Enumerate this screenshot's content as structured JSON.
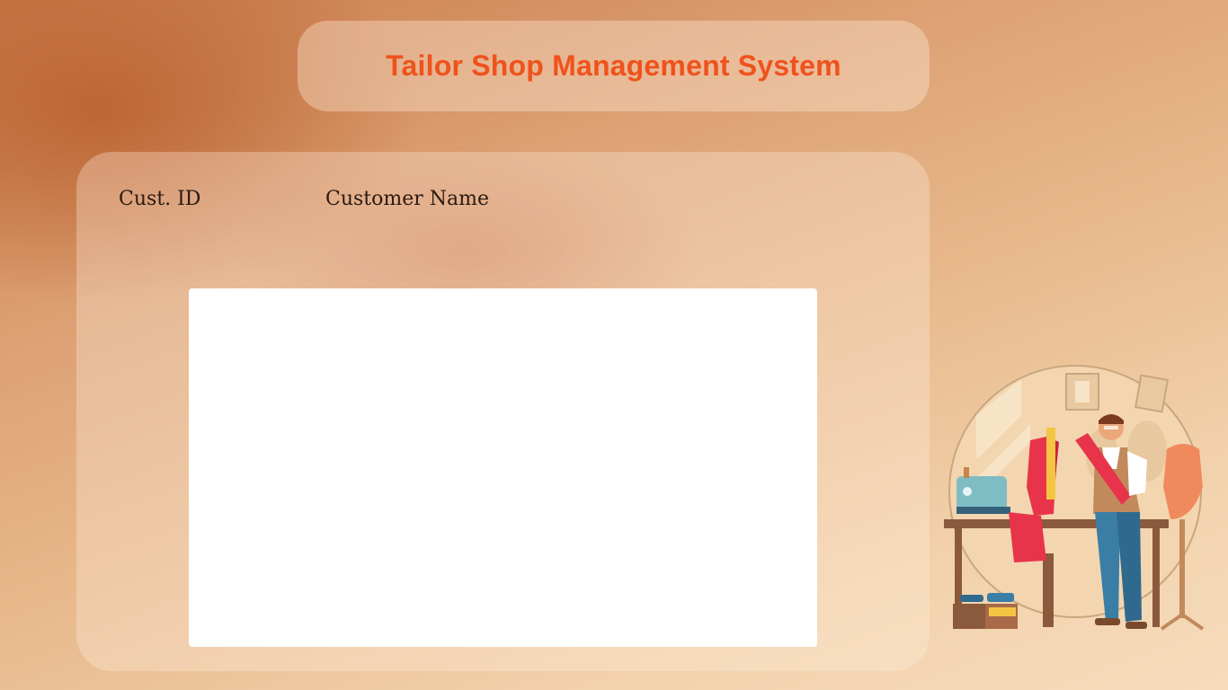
{
  "app": {
    "title": "Tailor Shop Management System"
  },
  "customer_table": {
    "columns": [
      "Cust. ID",
      "Customer Name"
    ],
    "rows": []
  },
  "illustration": {
    "icon": "tailor-illustration-icon"
  },
  "colors": {
    "title": "#f0521c",
    "header_text": "#2b1a10",
    "background_dark": "#c97a4a",
    "background_light": "#f6dcbc"
  }
}
